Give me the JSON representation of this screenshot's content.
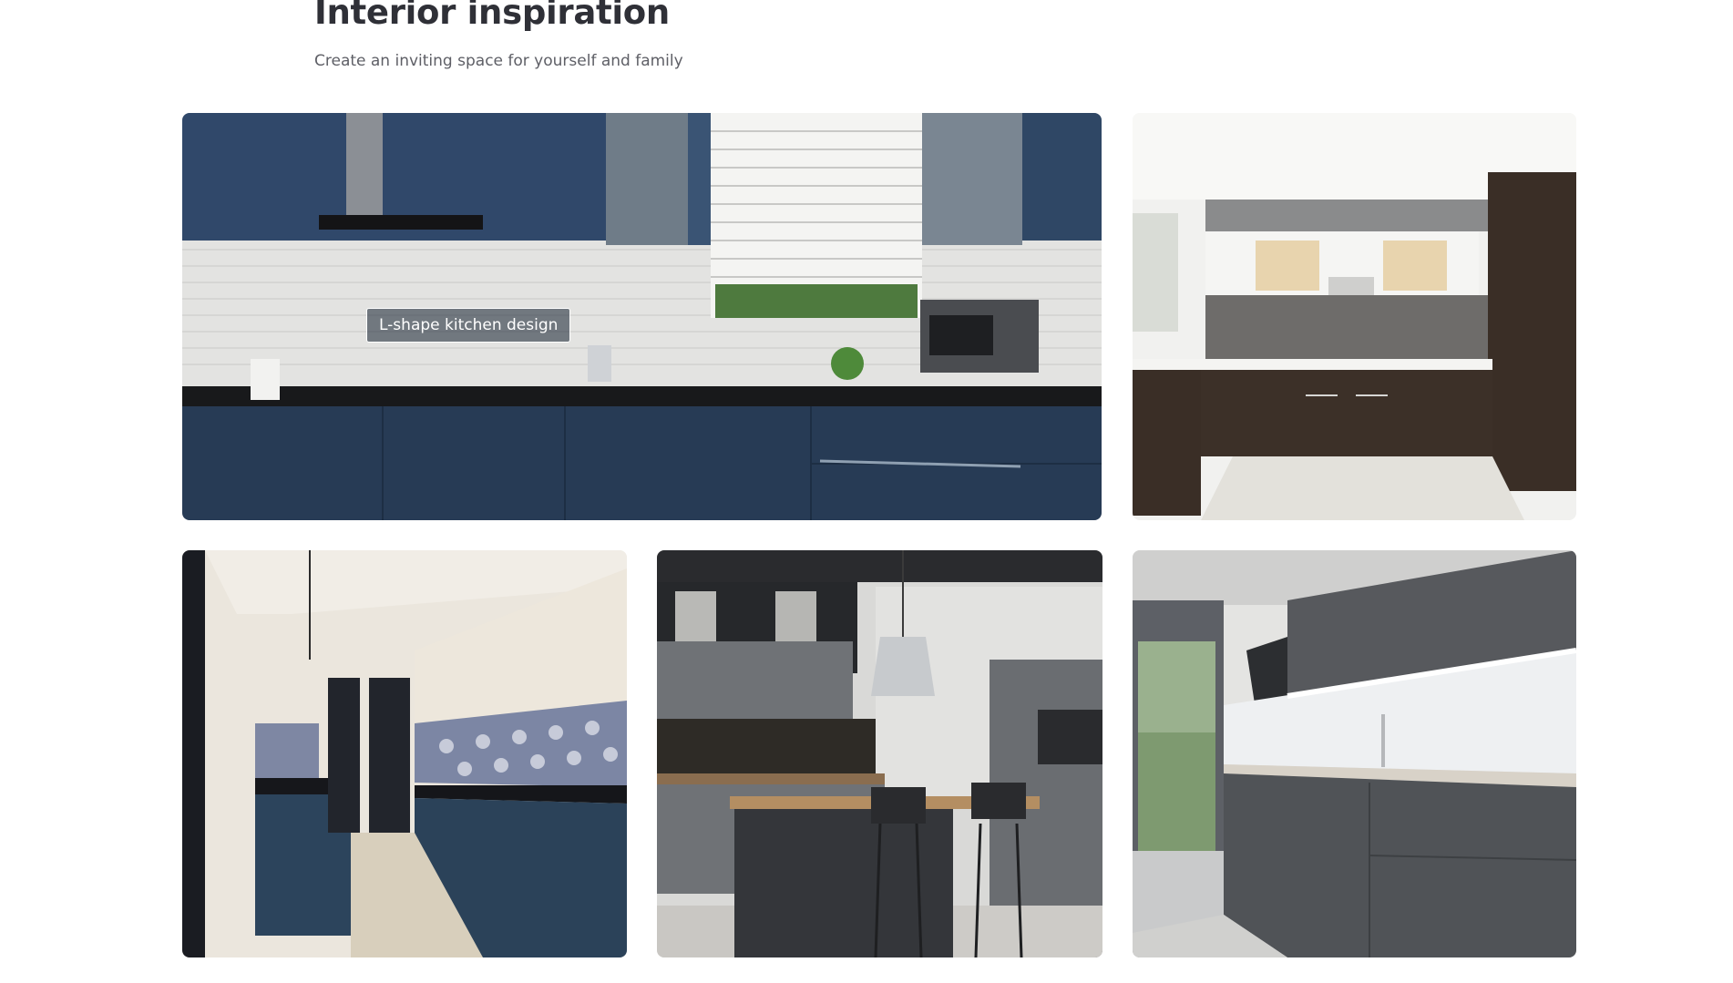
{
  "section": {
    "title": "Interior inspiration",
    "subtitle": "Create an inviting space for yourself and family"
  },
  "gallery": [
    {
      "caption": "L-shape kitchen design",
      "theme": "blue lacquer L-shape kitchen with white subway tiles",
      "palette": {
        "cabinet": "#2e4660",
        "wall": "#e4e4e2",
        "counter": "#1a1a1c"
      }
    },
    {
      "theme": "U-shape kitchen with dark wood cabinets",
      "palette": {
        "cabinet": "#3d3129",
        "wall": "#f0f0ee",
        "floor": "#e2e0da"
      }
    },
    {
      "theme": "parallel kitchen with blue base cabinets and patterned tiles",
      "palette": {
        "cabinet": "#2b4358",
        "wall": "#ece6dc",
        "floor": "#d9d0bd"
      }
    },
    {
      "theme": "grey island kitchen with pendant lamp",
      "palette": {
        "cabinet": "#5a5d62",
        "wall": "#d8d8d6",
        "floor": "#c8c6c2"
      }
    },
    {
      "theme": "grey L-shape kitchen with balcony door",
      "palette": {
        "cabinet": "#55585c",
        "wall": "#e6e6e4",
        "floor": "#cfcfcd"
      }
    }
  ]
}
